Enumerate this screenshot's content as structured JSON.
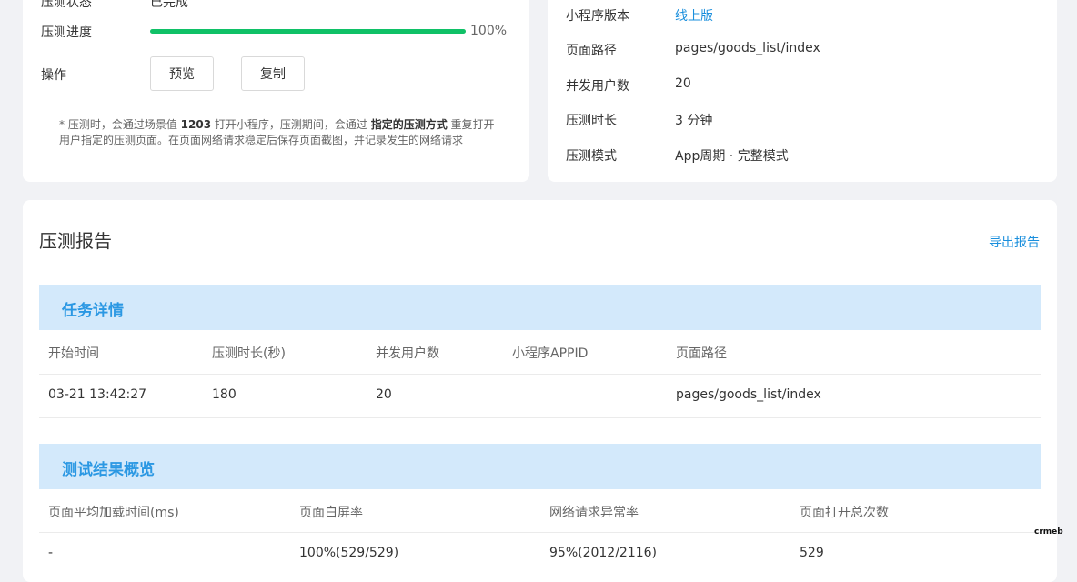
{
  "left_panel": {
    "status_label": "压测状态",
    "status_value": "已完成",
    "progress_label": "压测进度",
    "progress_value": 1.0,
    "progress_text": "100%",
    "actions_label": "操作",
    "preview_button": "预览",
    "copy_button": "复制",
    "note": {
      "p1": "* 压测时，会通过场景值 ",
      "scene": "1203",
      "p2": " 打开小程序，压测期间，会通过 ",
      "mode": "指定的压测方式",
      "p3": " 重复打开",
      "line2": "用户指定的压测页面。在页面网络请求稳定后保存页面截图，并记录发生的网络请求"
    }
  },
  "right_panel": {
    "rows": [
      {
        "label": "小程序版本",
        "value": "线上版"
      },
      {
        "label": "页面路径",
        "value": "pages/goods_list/index"
      },
      {
        "label": "并发用户数",
        "value": "20"
      },
      {
        "label": "压测时长",
        "value": "3 分钟"
      },
      {
        "label": "压测模式",
        "value": "App周期 · 完整模式"
      }
    ]
  },
  "report": {
    "title": "压测报告",
    "export_link": "导出报告",
    "task": {
      "title": "任务详情",
      "headers": [
        "开始时间",
        "压测时长(秒)",
        "并发用户数",
        "小程序APPID",
        "页面路径"
      ],
      "row": [
        "03-21 13:42:27",
        "180",
        "20",
        "",
        "pages/goods_list/index"
      ]
    },
    "summary": {
      "title": "测试结果概览",
      "headers": [
        "页面平均加载时间(ms)",
        "页面白屏率",
        "网络请求异常率",
        "页面打开总次数"
      ],
      "row": [
        "-",
        "100%(529/529)",
        "95%(2012/2116)",
        "529"
      ]
    }
  },
  "watermark": "crmeb"
}
